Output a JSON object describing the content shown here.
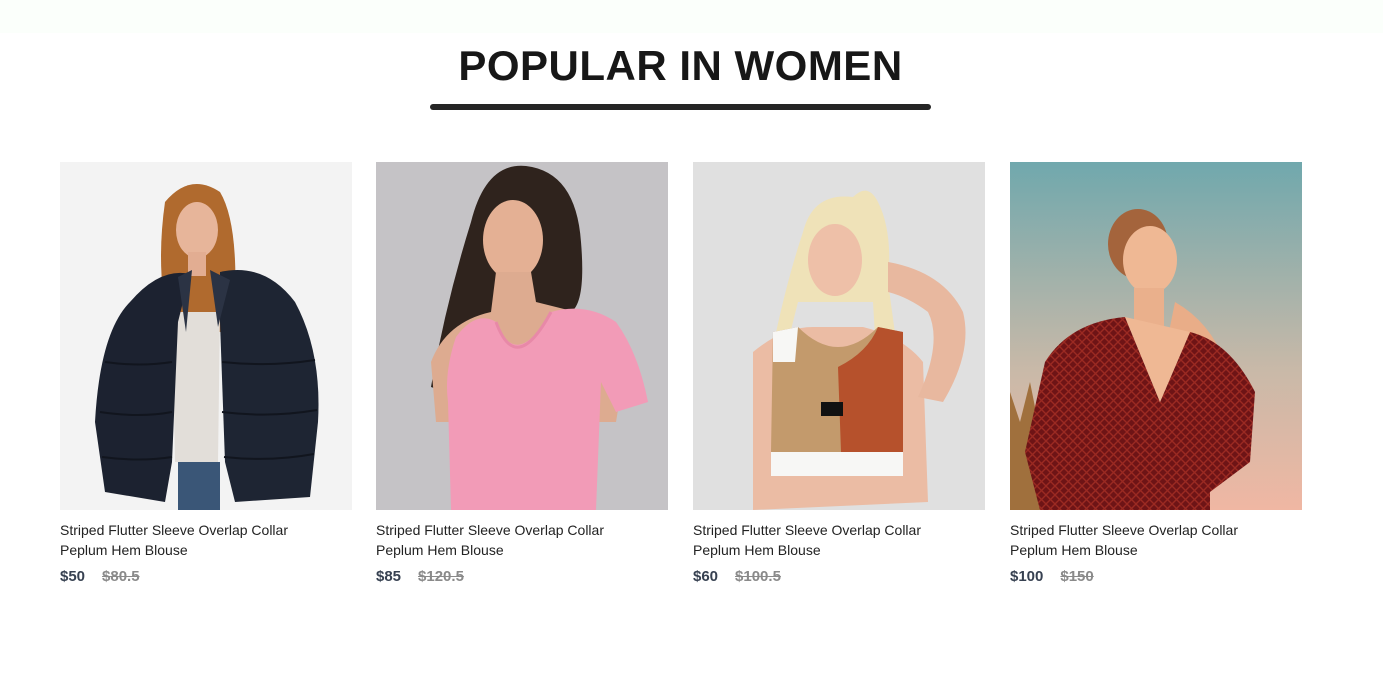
{
  "section": {
    "title": "POPULAR IN WOMEN"
  },
  "products": [
    {
      "name": "Striped Flutter Sleeve Overlap Collar Peplum Hem Blouse",
      "new_price": "$50",
      "old_price": "$80.5",
      "image_icon": "woman-black-fur-jacket-photo"
    },
    {
      "name": "Striped Flutter Sleeve Overlap Collar Peplum Hem Blouse",
      "new_price": "$85",
      "old_price": "$120.5",
      "image_icon": "woman-pink-top-photo"
    },
    {
      "name": "Striped Flutter Sleeve Overlap Collar Peplum Hem Blouse",
      "new_price": "$60",
      "old_price": "$100.5",
      "image_icon": "woman-sports-crop-top-photo"
    },
    {
      "name": "Striped Flutter Sleeve Overlap Collar Peplum Hem Blouse",
      "new_price": "$100",
      "old_price": "$150",
      "image_icon": "woman-red-blouse-photo"
    }
  ],
  "colors": {
    "title": "#171717",
    "underline": "#252525",
    "new_price": "#374151",
    "old_price": "#8a8a8a"
  }
}
